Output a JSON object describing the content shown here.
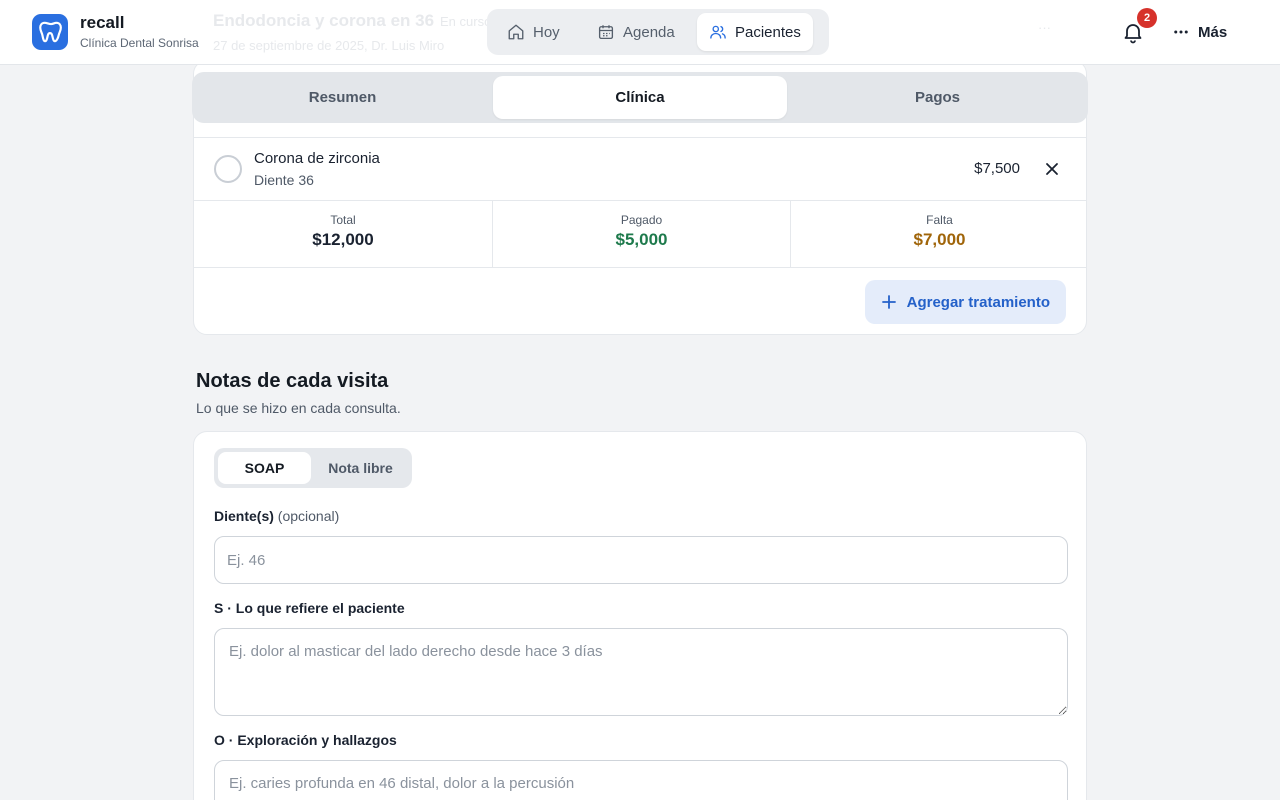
{
  "header": {
    "brand": {
      "name": "recall",
      "subtitle": "Clínica Dental Sonrisa",
      "logo_icon": "tooth-icon"
    },
    "nav": [
      {
        "label": "Hoy",
        "icon": "home-icon",
        "active": false
      },
      {
        "label": "Agenda",
        "icon": "calendar-icon",
        "active": false
      },
      {
        "label": "Pacientes",
        "icon": "users-icon",
        "active": true
      }
    ],
    "notifications": {
      "count": "2",
      "icon": "bell-icon"
    },
    "more": {
      "label": "Más",
      "icon": "ellipsis-icon"
    }
  },
  "background_header": {
    "title": "Endodoncia y corona en 36",
    "tag": "En curso",
    "subtitle": "27 de septiembre de 2025, Dr. Luis Miro",
    "action": "···"
  },
  "section_tabs": [
    {
      "label": "Resumen",
      "active": false
    },
    {
      "label": "Clínica",
      "active": true
    },
    {
      "label": "Pagos",
      "active": false
    }
  ],
  "treatment": {
    "items": [
      {
        "title": "Corona de zirconia",
        "subtitle": "Diente 36",
        "price": "$7,500"
      }
    ],
    "totals": [
      {
        "label": "Total",
        "value": "$12,000",
        "color": "#1a2230"
      },
      {
        "label": "Pagado",
        "value": "$5,000",
        "color": "#1e7a4c"
      },
      {
        "label": "Falta",
        "value": "$7,000",
        "color": "#a0650a"
      }
    ],
    "add_button": "Agregar tratamiento"
  },
  "notes": {
    "title": "Notas de cada visita",
    "subtitle": "Lo que se hizo en cada consulta.",
    "modes": [
      {
        "label": "SOAP",
        "active": true
      },
      {
        "label": "Nota libre",
        "active": false
      }
    ],
    "tooth_field": {
      "label": "Diente(s)",
      "optional": "(opcional)",
      "placeholder": "Ej. 46",
      "value": ""
    },
    "subjective": {
      "label": "S · Lo que refiere el paciente",
      "placeholder": "Ej. dolor al masticar del lado derecho desde hace 3 días",
      "value": ""
    },
    "objective": {
      "label": "O · Exploración y hallazgos",
      "placeholder": "Ej. caries profunda en 46 distal, dolor a la percusión",
      "value": ""
    }
  },
  "colors": {
    "accent": "#2a6fe0",
    "badge": "#d6322b",
    "paid": "#1e7a4c",
    "due": "#a0650a"
  }
}
